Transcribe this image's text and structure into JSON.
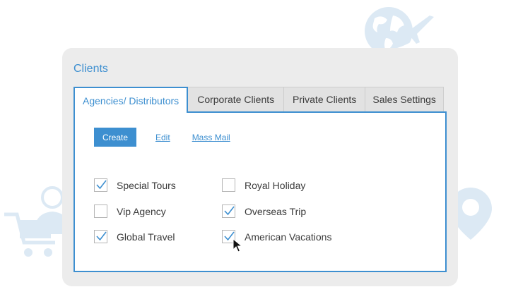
{
  "window": {
    "title": "Clients"
  },
  "tabs": [
    {
      "label": "Agencies/ Distributors",
      "active": true
    },
    {
      "label": "Corporate Clients",
      "active": false
    },
    {
      "label": "Private Clients",
      "active": false
    },
    {
      "label": "Sales Settings",
      "active": false
    }
  ],
  "toolbar": {
    "create_label": "Create",
    "edit_label": "Edit",
    "mass_mail_label": "Mass Mail"
  },
  "clients": [
    {
      "label": "Special Tours",
      "checked": true
    },
    {
      "label": "Royal Holiday",
      "checked": false
    },
    {
      "label": "Vip Agency",
      "checked": false
    },
    {
      "label": "Overseas Trip",
      "checked": true
    },
    {
      "label": "Global Travel",
      "checked": true
    },
    {
      "label": "American Vacations",
      "checked": true
    }
  ],
  "icons": {
    "background": [
      "globe-airplane-icon",
      "person-shopping-cart-icon",
      "location-pin-icon"
    ],
    "pointer": "mouse-pointer-icon"
  },
  "colors": {
    "accent": "#3d8fd0",
    "decor": "#dce9f4",
    "window_bg": "#ececec"
  }
}
